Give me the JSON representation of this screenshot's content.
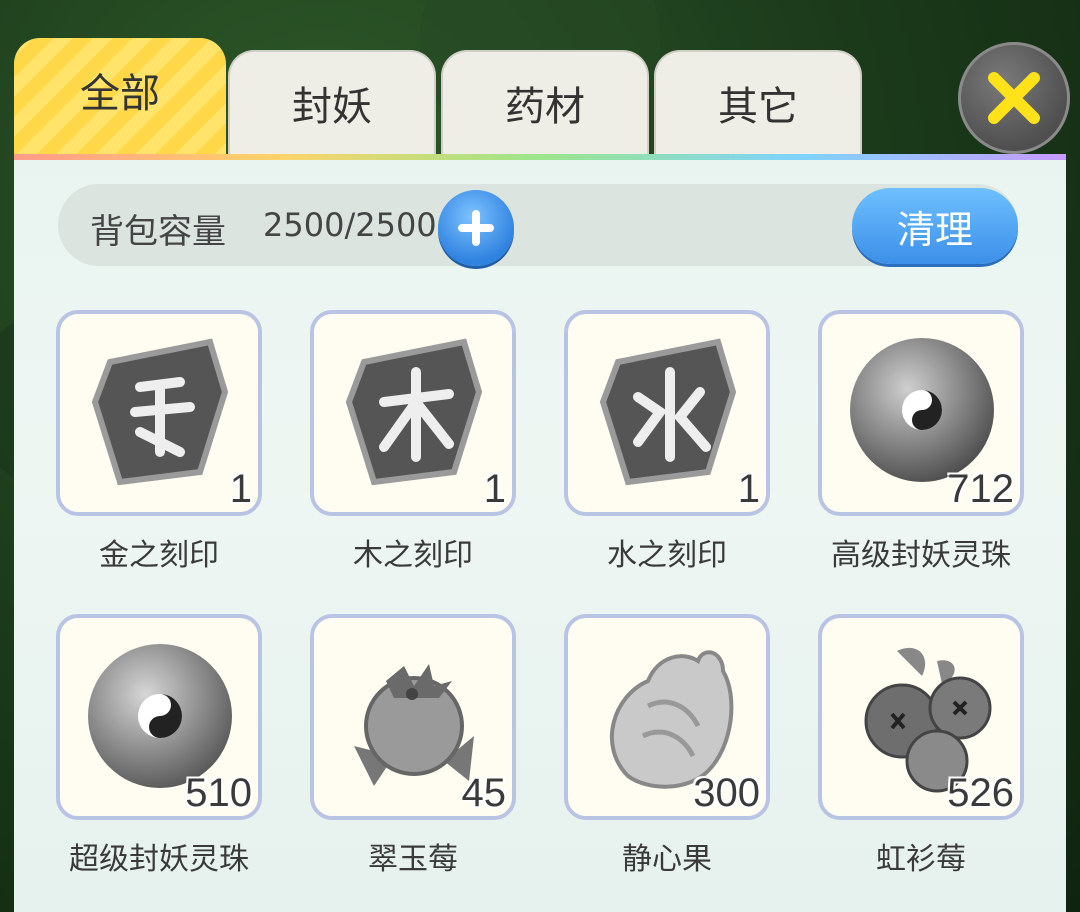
{
  "tabs": [
    {
      "label": "全部",
      "active": true
    },
    {
      "label": "封妖",
      "active": false
    },
    {
      "label": "药材",
      "active": false
    },
    {
      "label": "其它",
      "active": false
    }
  ],
  "close_icon": "close-x-icon",
  "capacity": {
    "label": "背包容量",
    "value": "2500/2500",
    "plus_icon": "plus-icon",
    "clean_label": "清理"
  },
  "items": [
    {
      "name": "金之刻印",
      "count": "1",
      "icon": "metal-seal-icon"
    },
    {
      "name": "木之刻印",
      "count": "1",
      "icon": "wood-seal-icon"
    },
    {
      "name": "水之刻印",
      "count": "1",
      "icon": "water-seal-icon"
    },
    {
      "name": "高级封妖灵珠",
      "count": "712",
      "icon": "taiji-orb-icon"
    },
    {
      "name": "超级封妖灵珠",
      "count": "510",
      "icon": "taiji-orb-icon"
    },
    {
      "name": "翠玉莓",
      "count": "45",
      "icon": "berry-icon"
    },
    {
      "name": "静心果",
      "count": "300",
      "icon": "fruit-icon"
    },
    {
      "name": "虹衫莓",
      "count": "526",
      "icon": "blueberry-icon"
    }
  ],
  "colors": {
    "active_tab": "#ffe36a",
    "accent_blue": "#3b8fe8",
    "close_x": "#ffe21a"
  }
}
